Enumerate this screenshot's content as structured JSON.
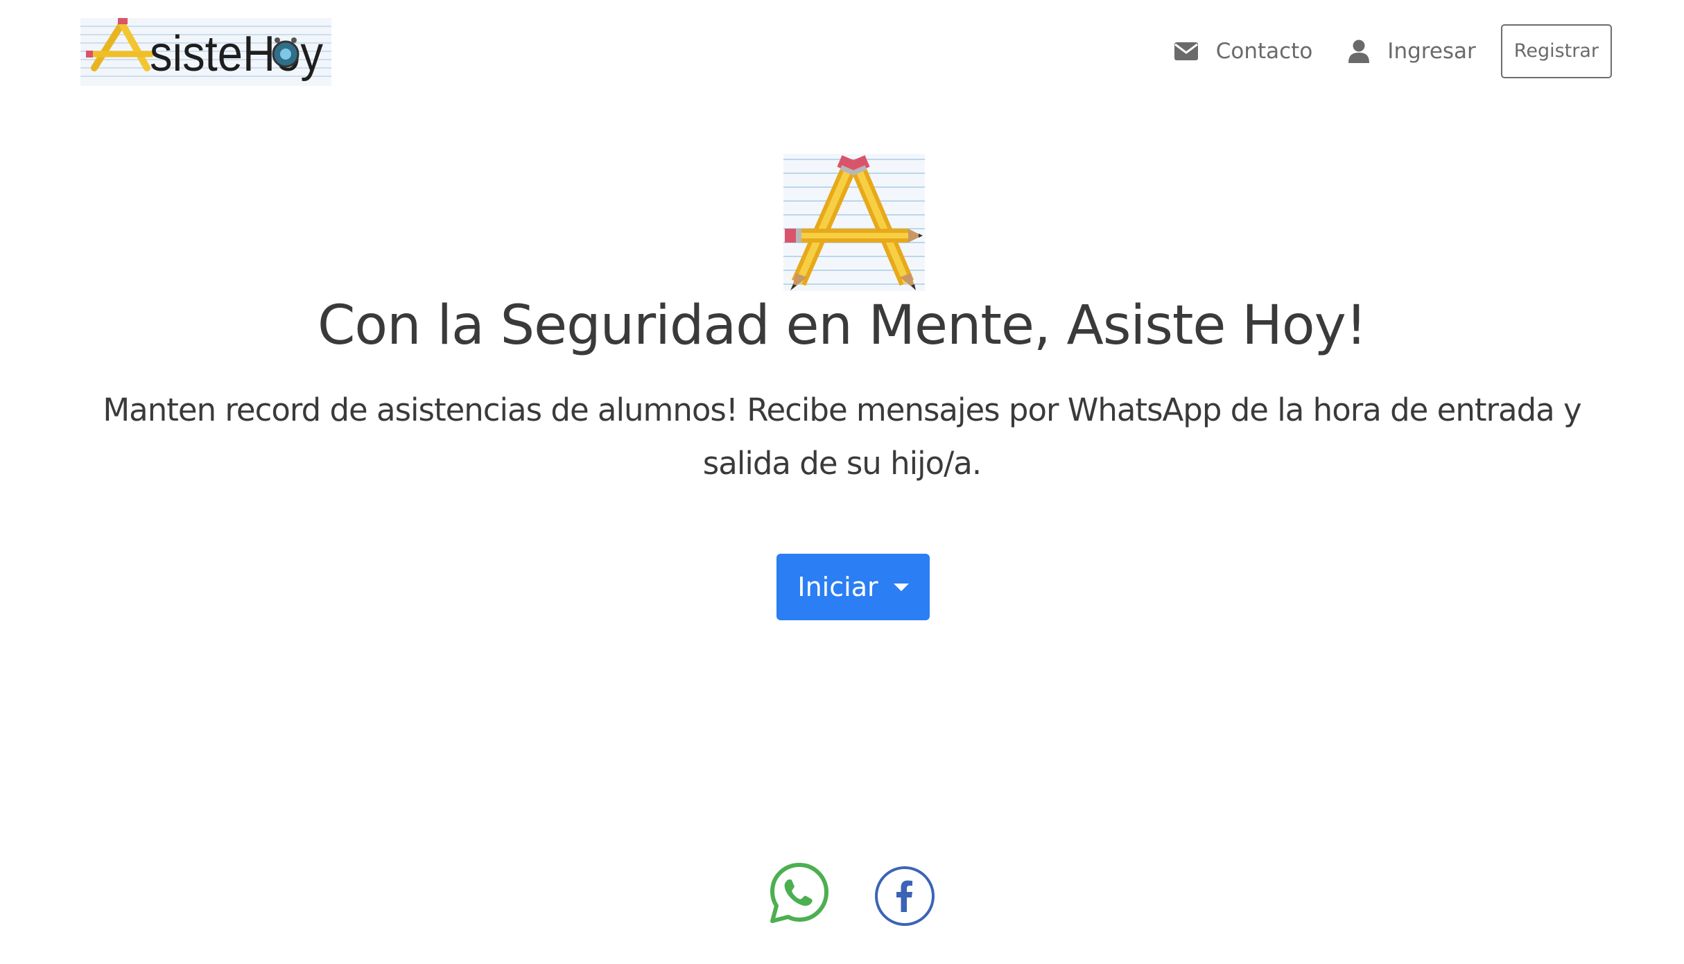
{
  "navbar": {
    "brand_alt": "AsisteHoy",
    "links": [
      {
        "label": "Contacto",
        "icon": "envelope-icon"
      },
      {
        "label": "Ingresar",
        "icon": "user-icon"
      }
    ],
    "register_label": "Registrar"
  },
  "hero": {
    "title": "Con la Seguridad en Mente, Asiste Hoy!",
    "lead": "Manten record de asistencias de alumnos! Recibe mensajes por WhatsApp de la hora de entrada y salida de su hijo/a.",
    "start_button": "Iniciar"
  },
  "social": [
    {
      "name": "whatsapp",
      "icon": "whatsapp-icon",
      "color": "#4caf50"
    },
    {
      "name": "facebook",
      "icon": "facebook-icon",
      "color": "#3b64b6"
    }
  ],
  "colors": {
    "primary": "#2b7ef3",
    "text": "#3a3a3a",
    "muted": "#6a6a6a"
  }
}
